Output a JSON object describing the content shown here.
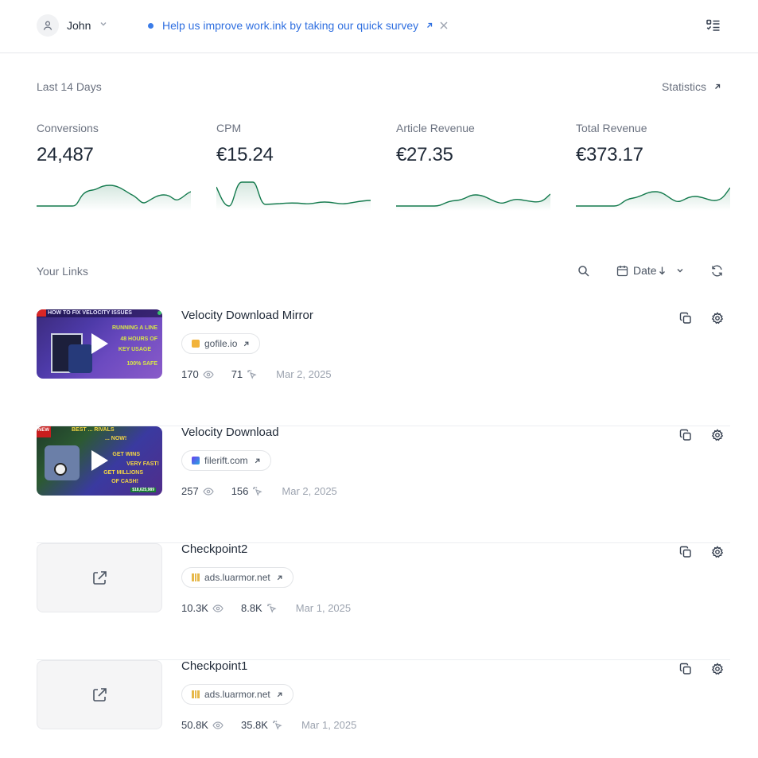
{
  "header": {
    "user_name": "John",
    "survey_text": "Help us improve work.ink by taking our quick survey",
    "icons": {
      "user": "user-icon",
      "chevron": "chevron-down-icon",
      "external": "external-arrow-icon",
      "close": "close-icon",
      "menu": "checklist-menu-icon"
    }
  },
  "stats": {
    "period_label": "Last 14 Days",
    "statistics_link": "Statistics",
    "metrics": [
      {
        "label": "Conversions",
        "value": "24,487"
      },
      {
        "label": "CPM",
        "value": "€15.24"
      },
      {
        "label": "Article Revenue",
        "value": "€27.35"
      },
      {
        "label": "Total Revenue",
        "value": "€373.17"
      }
    ],
    "sparkline_color": "#137a4d"
  },
  "links_section": {
    "title": "Your Links",
    "sort_label": "Date",
    "icons": {
      "search": "search-icon",
      "calendar": "calendar-icon",
      "sort": "arrow-down-icon",
      "refresh": "refresh-icon"
    }
  },
  "links": [
    {
      "title": "Velocity Download Mirror",
      "domain": "gofile.io",
      "views": "170",
      "clicks": "71",
      "date": "Mar 2, 2025",
      "thumbnail": "video",
      "thumbnail_text": [
        "HOW TO FIX VELOCITY ISSUES",
        "RUNNING A LINE",
        "48 HOURS OF",
        "KEY USAGE",
        "100% SAFE"
      ]
    },
    {
      "title": "Velocity Download",
      "domain": "filerift.com",
      "views": "257",
      "clicks": "156",
      "date": "Mar 2, 2025",
      "thumbnail": "video",
      "thumbnail_text": [
        "NEW",
        "BEST ... RIVALS",
        "... NOW!",
        "GET WINS",
        "VERY FAST!",
        "GET MILLIONS",
        "OF CASH!",
        "$18,625,989"
      ]
    },
    {
      "title": "Checkpoint2",
      "domain": "ads.luarmor.net",
      "views": "10.3K",
      "clicks": "8.8K",
      "date": "Mar 1, 2025",
      "thumbnail": "external-link"
    },
    {
      "title": "Checkpoint1",
      "domain": "ads.luarmor.net",
      "views": "50.8K",
      "clicks": "35.8K",
      "date": "Mar 1, 2025",
      "thumbnail": "external-link"
    }
  ]
}
